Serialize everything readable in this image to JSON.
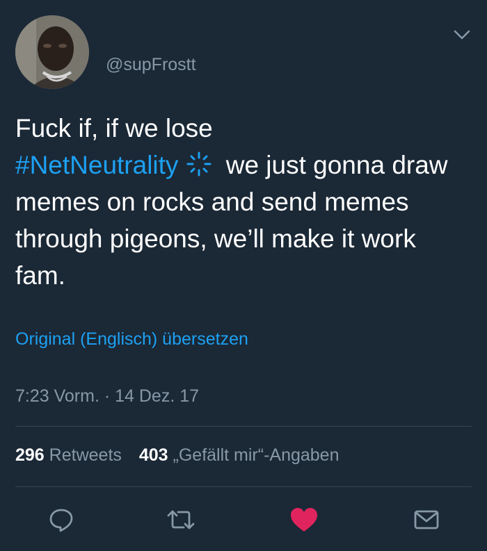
{
  "tweet": {
    "handle": "@supFrostt",
    "text_line1": "Fuck if, if we lose",
    "hashtag": "#NetNeutrality",
    "text_after_hashtag": "we just gonna",
    "text_rest": "draw memes on rocks and send memes through pigeons, we’ll make it work fam.",
    "translate_link": "Original (Englisch) übersetzen",
    "timestamp": "7:23 Vorm. · 14 Dez. 17"
  },
  "stats": {
    "retweets_count": "296",
    "retweets_label": "Retweets",
    "likes_count": "403",
    "likes_label": "„Gefällt mir“-Angaben"
  },
  "colors": {
    "background": "#1b2836",
    "accent": "#1da1f2",
    "muted": "#8899a6",
    "like": "#e0245e",
    "divider": "#38444d"
  },
  "icons": {
    "menu": "chevron-down-icon",
    "hashtag_emoji": "spark-loading-icon",
    "reply": "reply-icon",
    "retweet": "retweet-icon",
    "like": "heart-icon",
    "dm": "envelope-icon"
  }
}
